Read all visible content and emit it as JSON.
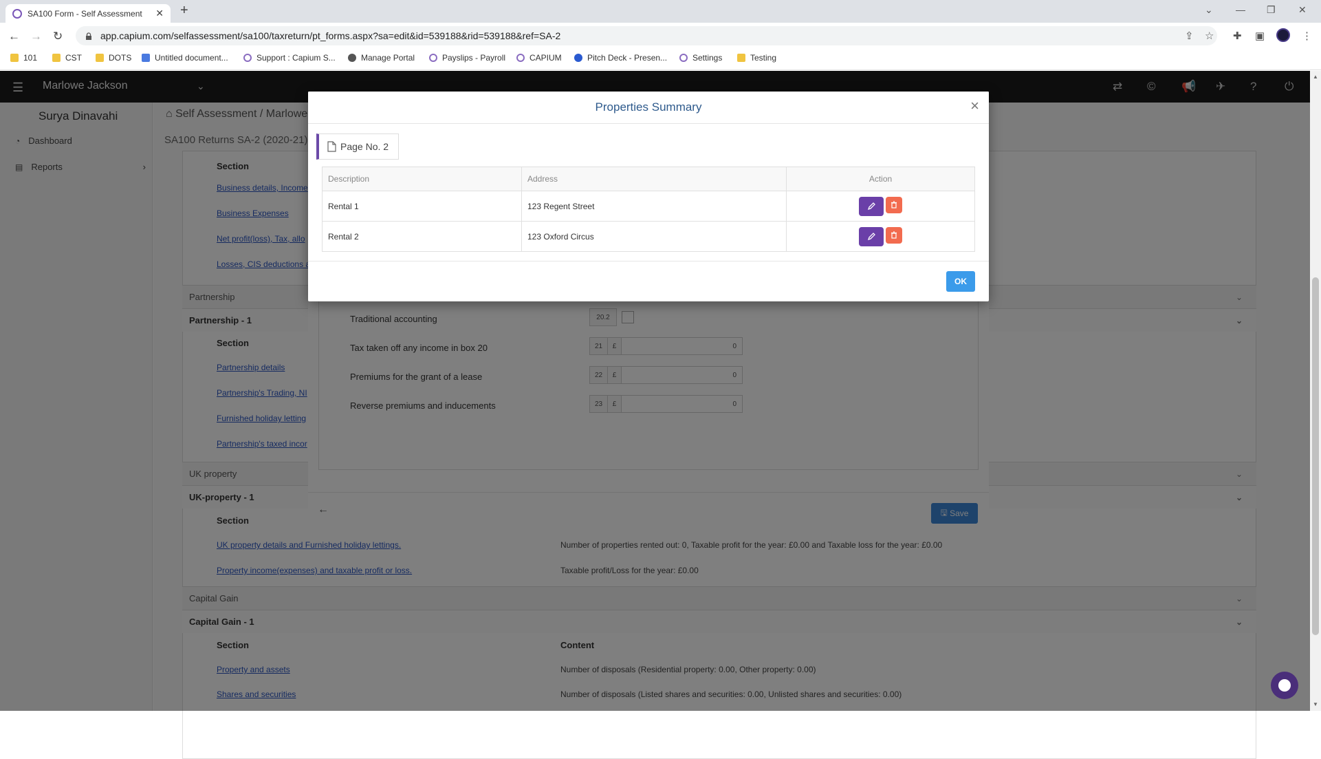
{
  "browser": {
    "tab_title": "SA100 Form - Self Assessment",
    "url": "app.capium.com/selfassessment/sa100/taxreturn/pt_forms.aspx?sa=edit&id=539188&rid=539188&ref=SA-2",
    "bookmarks": [
      {
        "label": "101",
        "icon": "folder"
      },
      {
        "label": "CST",
        "icon": "folder"
      },
      {
        "label": "DOTS",
        "icon": "folder"
      },
      {
        "label": "Untitled document...",
        "icon": "doc"
      },
      {
        "label": "Support : Capium S...",
        "icon": "capium"
      },
      {
        "label": "Manage Portal",
        "icon": "globe"
      },
      {
        "label": "Payslips - Payroll",
        "icon": "capium"
      },
      {
        "label": "CAPIUM",
        "icon": "capium"
      },
      {
        "label": "Pitch Deck - Presen...",
        "icon": "pitch"
      },
      {
        "label": "Settings",
        "icon": "capium"
      },
      {
        "label": "Testing",
        "icon": "folder"
      }
    ]
  },
  "app": {
    "client_name": "Marlowe Jackson",
    "sidebar": {
      "user_name": "Surya Dinavahi",
      "items": [
        {
          "label": "Dashboard",
          "icon": "dashboard-icon"
        },
        {
          "label": "Reports",
          "icon": "reports-icon"
        }
      ]
    },
    "breadcrumb": {
      "root": "Self Assessment",
      "current": "Marlowe"
    },
    "returns_title": "SA100 Returns SA-2 (2020-21)",
    "sections": {
      "section_header": "Section",
      "content_header": "Content",
      "self_employment_links": [
        "Business details, Income",
        "Business Expenses",
        "Net profit(loss), Tax, allo",
        "Losses, CIS deductions a"
      ],
      "partnership": "Partnership",
      "partnership_1": "Partnership - 1",
      "partnership_links": [
        "Partnership details",
        "Partnership's Trading, NI",
        "Furnished holiday letting",
        "Partnership's taxed incor"
      ],
      "uk_property": "UK property",
      "uk_property_1": "UK-property - 1",
      "uk_links": [
        "UK property details and Furnished holiday lettings.",
        "Property income(expenses) and taxable profit or loss."
      ],
      "uk_contents": [
        "Number of properties rented out: 0, Taxable profit for the year: £0.00 and Taxable loss for the year: £0.00",
        "Taxable profit/Loss for the year: £0.00"
      ],
      "capital_gain": "Capital Gain",
      "capital_gain_1": "Capital Gain - 1",
      "cg_links": [
        "Property and assets",
        "Shares and securities"
      ],
      "cg_contents": [
        "Number of disposals (Residential property: 0.00, Other property: 0.00)",
        "Number of disposals (Listed shares and securities: 0.00, Unlisted shares and securities: 0.00)"
      ]
    }
  },
  "underlying_form": {
    "rows": [
      {
        "label": "Traditional accounting",
        "box": "20.2",
        "type": "checkbox"
      },
      {
        "label": "Tax taken off any income in box 20",
        "box": "21",
        "currency": "£",
        "value": "0"
      },
      {
        "label": "Premiums for the grant of a lease",
        "box": "22",
        "currency": "£",
        "value": "0"
      },
      {
        "label": "Reverse premiums and inducements",
        "box": "23",
        "currency": "£",
        "value": "0"
      }
    ],
    "save_label": "Save"
  },
  "modal": {
    "title": "Properties Summary",
    "close": "×",
    "page_label": "Page No. 2",
    "columns": [
      "Description",
      "Address",
      "Action"
    ],
    "rows": [
      {
        "description": "Rental 1",
        "address": "123 Regent Street"
      },
      {
        "description": "Rental 2",
        "address": "123 Oxford Circus"
      }
    ],
    "ok_label": "OK"
  },
  "colors": {
    "edit_button": "#6a3fa8",
    "delete_button": "#f26b4f",
    "ok_button": "#3b9bea",
    "save_button": "#3d86d6",
    "title_blue": "#2e5a8c"
  }
}
